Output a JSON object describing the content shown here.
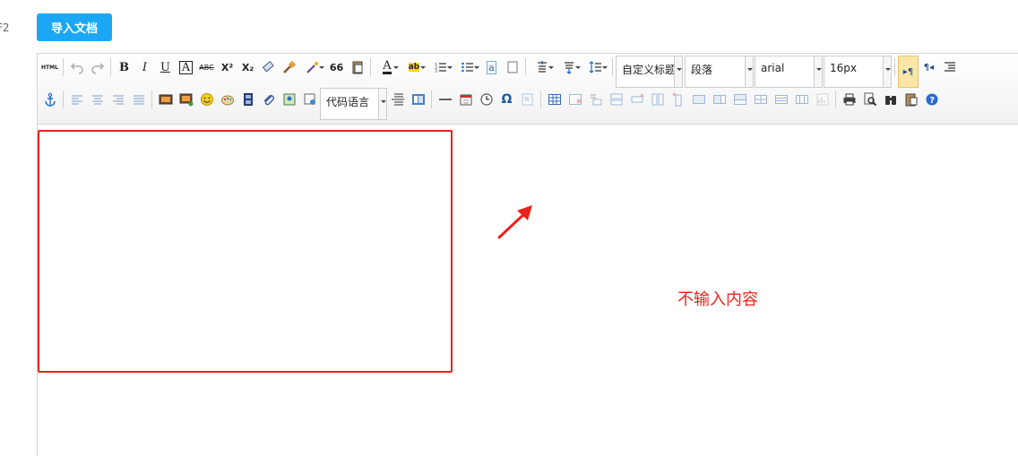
{
  "side_label": "F2",
  "import_button": {
    "label": "导入文档",
    "color": "#1aa8f5"
  },
  "toolbar": {
    "html_label": "HTML",
    "bold": "B",
    "italic": "I",
    "underline": "U",
    "superscript": "X²",
    "subscript": "X₂",
    "quote": "66",
    "font_color": "A",
    "omega": "Ω",
    "code_language": "代码语言",
    "custom_heading": "自定义标题",
    "paragraph_format": "段落",
    "font_family": "arial",
    "font_size": "16px"
  },
  "annotation": {
    "text": "不输入内容",
    "color": "#e8231c"
  }
}
